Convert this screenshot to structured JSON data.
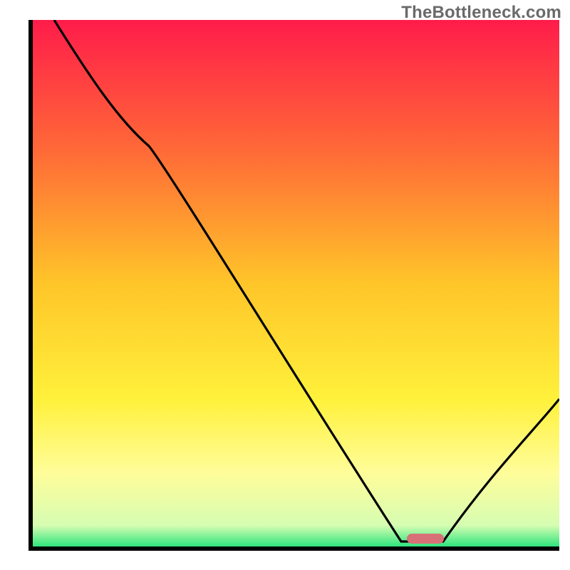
{
  "watermark": "TheBottleneck.com",
  "chart_data": {
    "type": "line",
    "title": "",
    "xlabel": "",
    "ylabel": "",
    "xlim": [
      0,
      100
    ],
    "ylim": [
      0,
      100
    ],
    "grid": false,
    "legend": false,
    "background": {
      "type": "vertical-gradient",
      "stops": [
        {
          "offset": 0,
          "color": "#ff1c4a"
        },
        {
          "offset": 25,
          "color": "#ff6a37"
        },
        {
          "offset": 50,
          "color": "#ffc529"
        },
        {
          "offset": 72,
          "color": "#fff13b"
        },
        {
          "offset": 86,
          "color": "#fffd9a"
        },
        {
          "offset": 96,
          "color": "#d6fdb2"
        },
        {
          "offset": 100,
          "color": "#2fe57e"
        }
      ]
    },
    "series": [
      {
        "name": "bottleneck-curve",
        "color": "#000000",
        "x": [
          4,
          15,
          22,
          70,
          78,
          100
        ],
        "y": [
          100,
          84,
          76,
          1,
          1,
          28
        ]
      }
    ],
    "marker": {
      "name": "optimal-range",
      "color": "#d87177",
      "x_range": [
        71,
        78
      ],
      "y": 1
    }
  }
}
